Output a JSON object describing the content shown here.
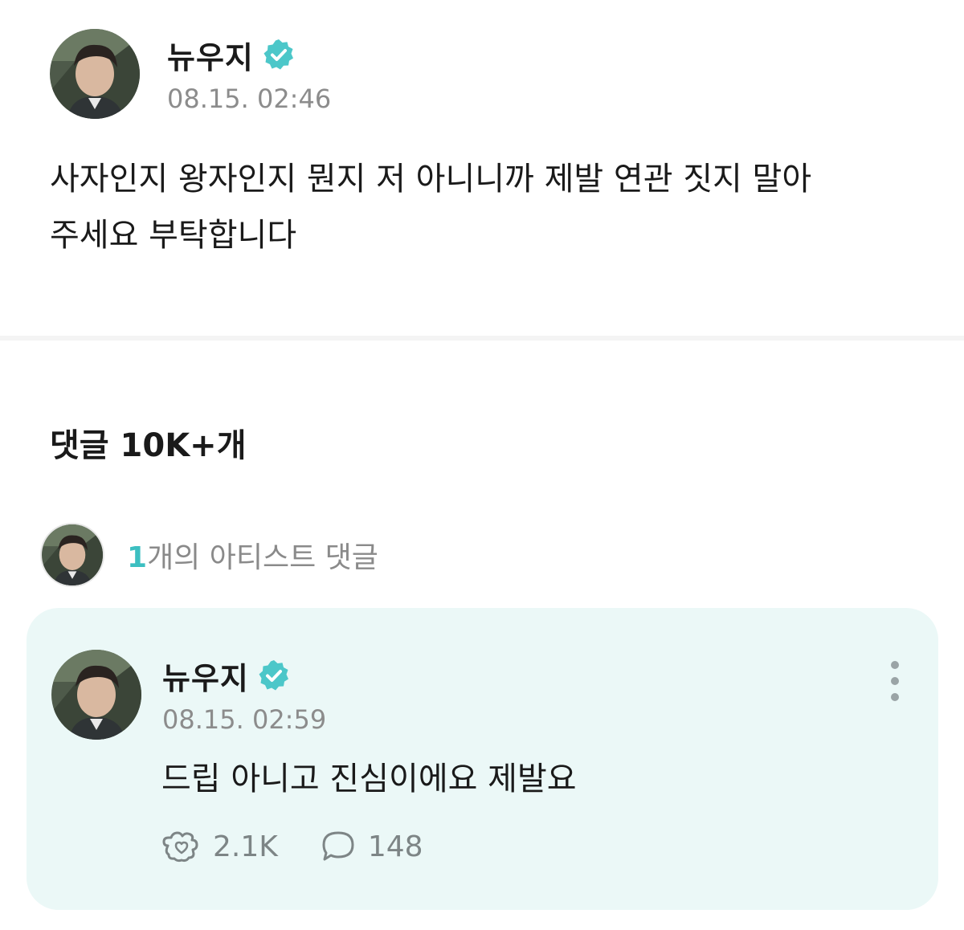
{
  "post": {
    "author": "뉴우지",
    "timestamp": "08.15. 02:46",
    "text_line1": "사자인지 왕자인지 뭔지 저 아니니까 제발 연관 짓지 말아",
    "text_line2": "주세요 부탁합니다"
  },
  "comments": {
    "title": "댓글 10K+개",
    "artist_count": "1",
    "artist_label": "개의 아티스트 댓글"
  },
  "artist_comment": {
    "author": "뉴우지",
    "timestamp": "08.15. 02:59",
    "text": "드립 아니고 진심이에요 제발요",
    "likes": "2.1K",
    "replies": "148"
  },
  "icons": {
    "verified": "verified-badge-icon",
    "like": "like-icon",
    "reply": "speech-bubble-icon",
    "more": "more-vertical-icon"
  },
  "colors": {
    "accent": "#4cc7c9",
    "card_background": "#ebf8f7",
    "muted_text": "#8c8c8c"
  }
}
